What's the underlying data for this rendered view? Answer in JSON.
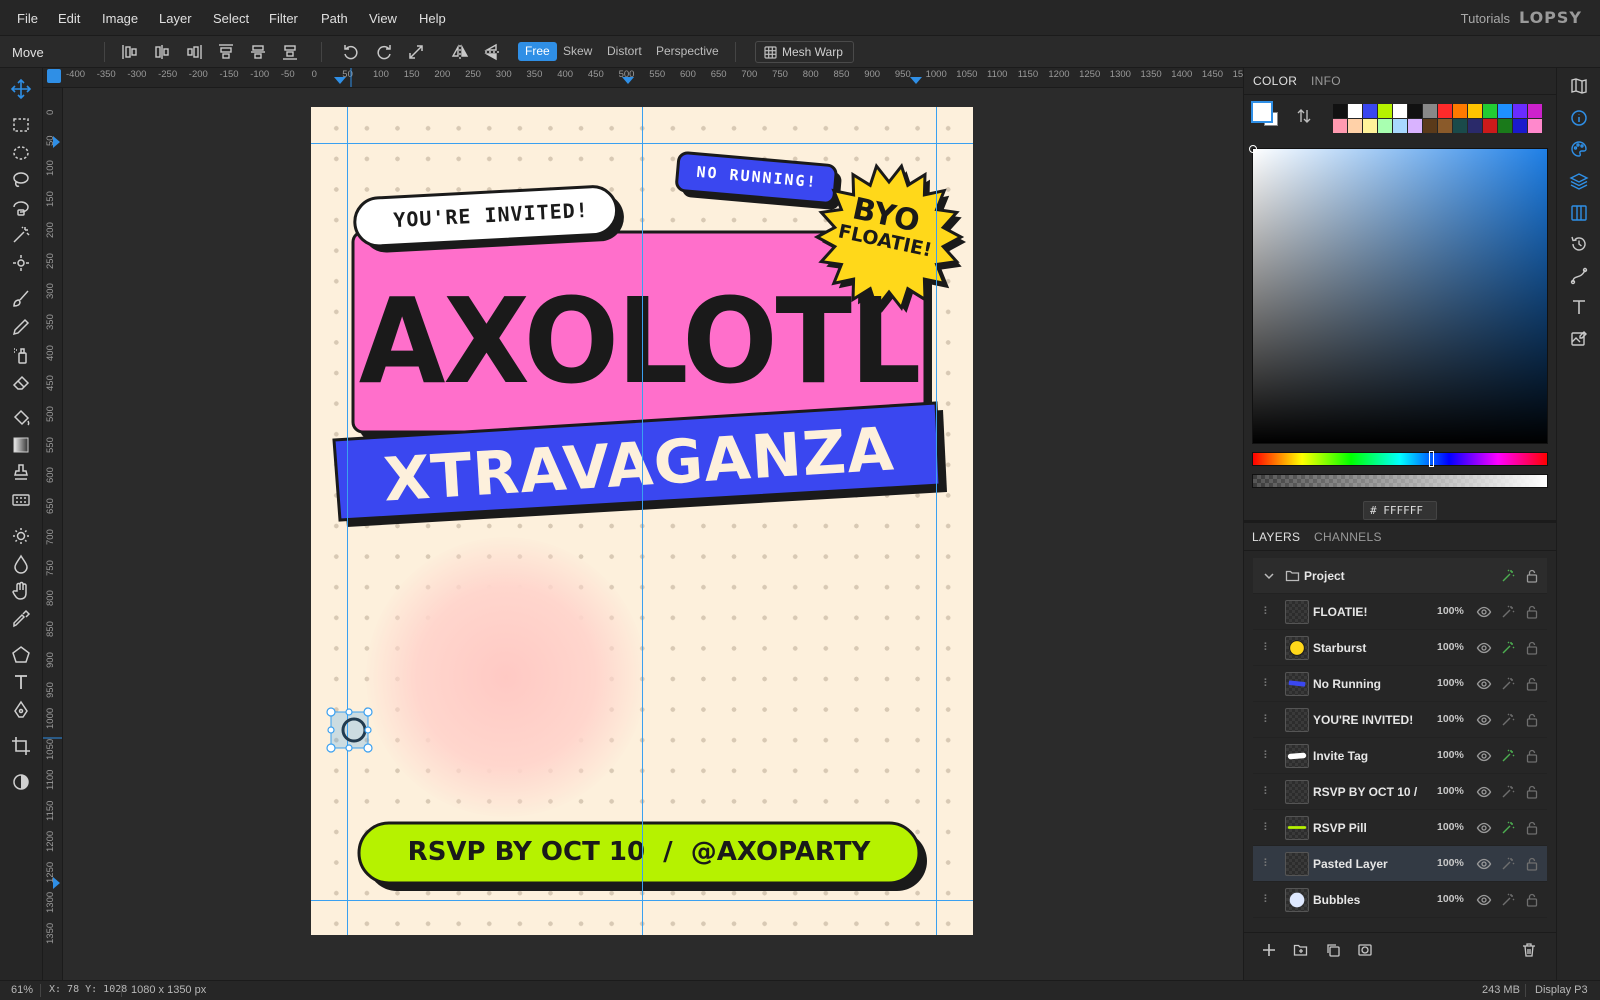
{
  "menubar": {
    "items": [
      "File",
      "Edit",
      "Image",
      "Layer",
      "Select",
      "Filter",
      "Path",
      "View",
      "Help"
    ],
    "tutorials": "Tutorials",
    "logo": "LOPSY"
  },
  "options": {
    "tool_name": "Move",
    "modes": [
      "Free",
      "Skew",
      "Distort",
      "Perspective"
    ],
    "active_mode": "Free",
    "mesh_warp": "Mesh Warp"
  },
  "ruler": {
    "top": [
      "-400",
      "-350",
      "-300",
      "-250",
      "-200",
      "-150",
      "-100",
      "-50",
      "0",
      "50",
      "100",
      "150",
      "200",
      "250",
      "300",
      "350",
      "400",
      "450",
      "500",
      "550",
      "600",
      "650",
      "700",
      "750",
      "800",
      "850",
      "900",
      "950",
      "1000",
      "1050",
      "1100",
      "1150",
      "1200",
      "1250",
      "1300",
      "1350",
      "1400",
      "1450",
      "15"
    ],
    "left": [
      "0",
      "50",
      "100",
      "150",
      "200",
      "250",
      "300",
      "350",
      "400",
      "450",
      "500",
      "550",
      "600",
      "650",
      "700",
      "750",
      "800",
      "850",
      "900",
      "950",
      "1000",
      "1050",
      "1100",
      "1150",
      "1200",
      "1250",
      "1300",
      "1350"
    ]
  },
  "poster": {
    "invite_tag": "YOU'RE INVITED!",
    "no_running": "NO RUNNING!",
    "starburst_line1": "BYO",
    "starburst_line2": "FLOATIE!",
    "title": "AXOLOTL",
    "subtitle": "XTRAVAGANZA",
    "rsvp": "RSVP BY OCT 10  /  @AXOPARTY",
    "colors": {
      "background": "#fdf0dc",
      "pink": "#ff6fcb",
      "blue": "#3a47f0",
      "lime": "#b6f200",
      "yellow": "#ffd81a",
      "ink": "#1a1a1a"
    }
  },
  "color_panel": {
    "tabs": [
      "COLOR",
      "INFO"
    ],
    "active_tab": "COLOR",
    "hex_prefix": "#",
    "hex": "FFFFFF",
    "swatches_row1": [
      "#111111",
      "#ffffff",
      "#3a47f0",
      "#b6f200",
      "#ffffff",
      "#111111",
      "#888888",
      "#ff2a2a",
      "#ff7a00",
      "#ffc400",
      "#22cc33",
      "#1e90ff",
      "#6a2cff",
      "#cc22cc"
    ],
    "swatches_row2": [
      "#ff9ab0",
      "#ffd1a8",
      "#fff29a",
      "#a8ffb0",
      "#a8d8ff",
      "#d9b3ff",
      "#5a3a1a",
      "#8a5a2a",
      "#1a4a4a",
      "#2a2a6a",
      "#cc1a1a",
      "#1a7a1a",
      "#1a1acc",
      "#ff88cc"
    ]
  },
  "layers_panel": {
    "tabs": [
      "LAYERS",
      "CHANNELS"
    ],
    "active_tab": "LAYERS",
    "group": "Project",
    "layers": [
      {
        "name": "FLOATIE!",
        "opacity": "100%",
        "thumb": "checker"
      },
      {
        "name": "Starburst",
        "opacity": "100%",
        "thumb": "starburst"
      },
      {
        "name": "No Running",
        "opacity": "100%",
        "thumb": "pill-blue"
      },
      {
        "name": "YOU'RE INVITED!",
        "opacity": "100%",
        "thumb": "checker"
      },
      {
        "name": "Invite Tag",
        "opacity": "100%",
        "thumb": "tag-white"
      },
      {
        "name": "RSVP BY OCT 10 /",
        "opacity": "100%",
        "thumb": "checker"
      },
      {
        "name": "RSVP Pill",
        "opacity": "100%",
        "thumb": "pill-lime"
      },
      {
        "name": "Pasted Layer",
        "opacity": "100%",
        "thumb": "checker"
      },
      {
        "name": "Bubbles",
        "opacity": "100%",
        "thumb": "bubble"
      }
    ],
    "selected": "Pasted Layer"
  },
  "status": {
    "zoom": "61%",
    "coords": "X: 78 Y: 1028",
    "doc_size": "1080 x 1350 px",
    "memory": "243 MB",
    "display": "Display P3"
  }
}
